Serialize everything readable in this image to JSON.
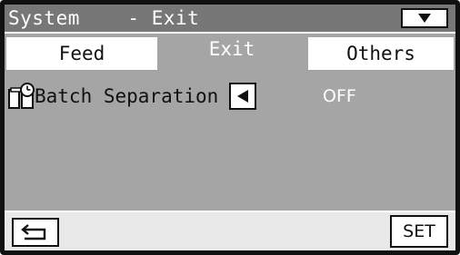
{
  "header": {
    "title": "System    - Exit",
    "dropdown_icon": "down-triangle-icon"
  },
  "tabs": [
    {
      "label": "Feed",
      "selected": false
    },
    {
      "label": "Exit",
      "selected": true
    },
    {
      "label": "Others",
      "selected": false
    }
  ],
  "settings": {
    "batch_separation": {
      "icon": "batch-separation-icon",
      "label": "Batch Separation",
      "value": "OFF",
      "left_icon": "left-triangle-icon"
    }
  },
  "footer": {
    "back_icon": "return-arrow-icon",
    "set_label": "SET"
  },
  "colors": {
    "panel": "#a5a5a5",
    "titlebar": "#777777",
    "bottombar": "#e8e8e8",
    "frame": "#111111"
  }
}
